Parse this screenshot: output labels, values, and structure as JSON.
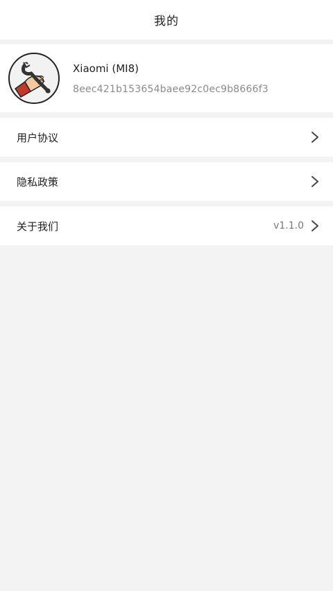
{
  "header": {
    "title": "我的"
  },
  "profile": {
    "device_name": "Xiaomi (MI8)",
    "device_id": "8eec421b153654baee92c0ec9b8666f3",
    "avatar_icon": "wrench-hand-icon"
  },
  "menu": {
    "items": [
      {
        "label": "用户协议",
        "value": ""
      },
      {
        "label": "隐私政策",
        "value": ""
      },
      {
        "label": "关于我们",
        "value": "v1.1.0"
      }
    ]
  },
  "colors": {
    "background": "#f3f3f3",
    "surface": "#ffffff",
    "text_primary": "#222222",
    "text_secondary": "#8a8a8a"
  }
}
